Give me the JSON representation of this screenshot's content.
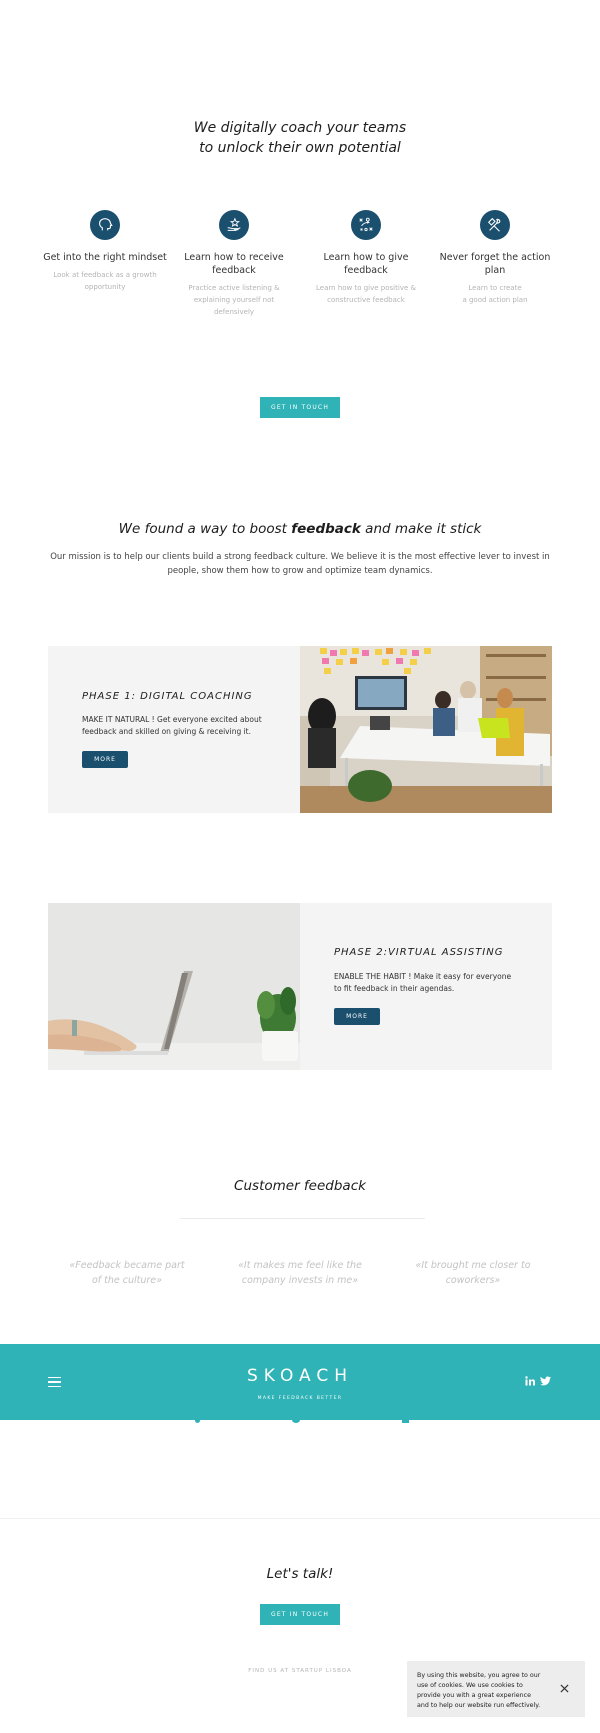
{
  "hero": {
    "title": "We digitally coach your teams\nto unlock their own potential",
    "features": [
      {
        "icon": "head-icon",
        "title": "Get into the right mindset",
        "desc": "Look at feedback as a growth\nopportunity"
      },
      {
        "icon": "hand-star-icon",
        "title": "Learn how to receive\nfeedback",
        "desc": "Practice active listening &\nexplaining yourself not\ndefensively"
      },
      {
        "icon": "strategy-icon",
        "title": "Learn how to give\nfeedback",
        "desc": "Learn how to give positive &\nconstructive feedback"
      },
      {
        "icon": "tools-icon",
        "title": "Never forget the action\nplan",
        "desc": "Learn to create\na good action plan"
      }
    ],
    "cta_label": "GET IN TOUCH"
  },
  "mission": {
    "title_pre": "We found a way to boost ",
    "title_bold": "feedback",
    "title_post": " and make it stick",
    "text": "Our mission is to help our clients build a strong feedback culture. We believe it is the most effective lever to invest in people, show them how to grow and optimize team dynamics."
  },
  "phases": [
    {
      "title": "PHASE 1: DIGITAL COACHING",
      "text": "MAKE IT NATURAL ! Get everyone excited about feedback and skilled on giving & receiving it.",
      "button_label": "MORE"
    },
    {
      "title": "PHASE 2:VIRTUAL ASSISTING",
      "text": "ENABLE THE HABIT ! Make it easy for everyone to fit feedback in their agendas.",
      "button_label": "MORE"
    }
  ],
  "testimonials": {
    "title": "Customer feedback",
    "quotes": [
      "«Feedback became part\nof the culture»",
      "«It makes me feel like the\ncompany invests in me»",
      "«It brought me closer to\ncoworkers»"
    ]
  },
  "brand": {
    "logo": "SKOACH",
    "tagline": "MAKE FEEDBACK BETTER"
  },
  "contact": {
    "title": "Let's talk!",
    "cta_label": "GET IN TOUCH",
    "find_us": "FIND US AT STARTUP LISBOA"
  },
  "cookie": {
    "text": "By using this website, you agree to our use of cookies. We use cookies to provide you with a great experience and to help our website run effectively."
  },
  "colors": {
    "teal": "#2fb3b6",
    "navy": "#1b4f6e"
  }
}
